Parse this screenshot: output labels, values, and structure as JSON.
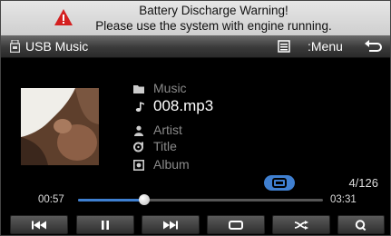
{
  "warning": {
    "title": "Battery Discharge Warning!",
    "message": "Please use the system with engine running."
  },
  "header": {
    "source_label": "USB Music",
    "menu_label": ":Menu",
    "icons": [
      "usb-icon",
      "list-icon",
      "back-icon"
    ]
  },
  "track": {
    "folder": "Music",
    "filename": "008.mp3",
    "artist": "Artist",
    "title": "Title",
    "album": "Album",
    "position": "4/126"
  },
  "playback": {
    "current_time": "00:57",
    "total_time": "03:31",
    "progress_fraction": 0.27,
    "repeat_active": true
  },
  "controls": [
    "previous-icon",
    "pause-icon",
    "next-icon",
    "repeat-icon",
    "shuffle-icon",
    "search-icon"
  ],
  "colors": {
    "accent": "#3e7fd0",
    "warning_icon": "#d42020"
  }
}
